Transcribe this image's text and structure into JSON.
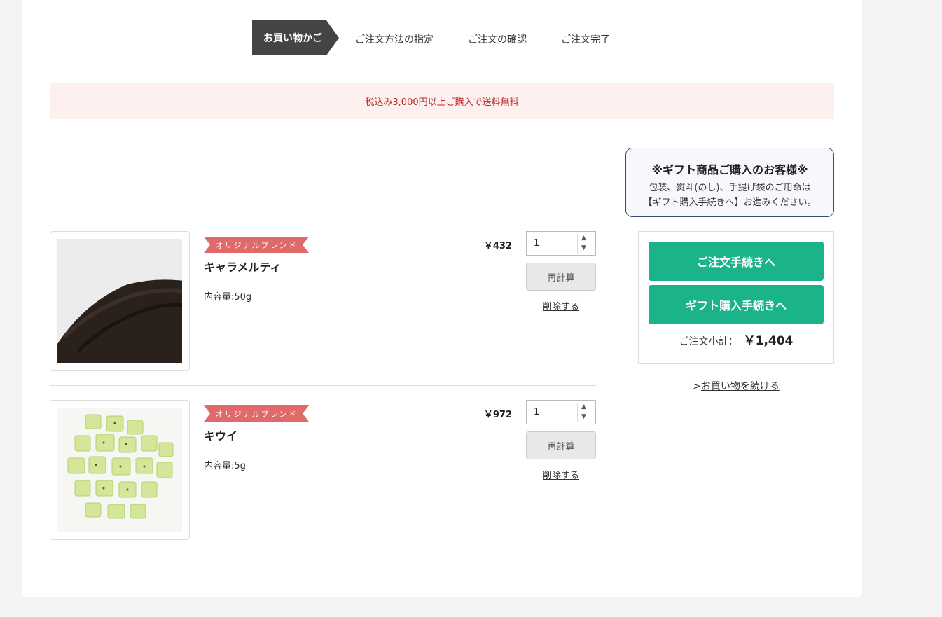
{
  "steps": [
    "お買い物かご",
    "ご注文方法の指定",
    "ご注文の確認",
    "ご注文完了"
  ],
  "notice": "税込み3,000円以上ご購入で送料無料",
  "gift_box": {
    "title": "※ギフト商品ご購入のお客様※",
    "line1": "包装、熨斗(のし)、手提げ袋のご用命は",
    "line2": "【ギフト購入手続きへ】お進みください。"
  },
  "order": {
    "checkout_label": "ご注文手続きへ",
    "gift_checkout_label": "ギフト購入手続きへ",
    "subtotal_label": "ご注文小計：",
    "subtotal_value": "￥1,404",
    "continue_prefix": ">",
    "continue_label": "お買い物を続ける"
  },
  "items": [
    {
      "badge": "オリジナルブレンド",
      "name": "キャラメルティ",
      "volume": "内容量:50g",
      "price": "￥432",
      "qty": "1",
      "recalc": "再計算",
      "delete": "削除する",
      "image": "black-tea-leaves"
    },
    {
      "badge": "オリジナルブレンド",
      "name": "キウイ",
      "volume": "内容量:5g",
      "price": "￥972",
      "qty": "1",
      "recalc": "再計算",
      "delete": "削除する",
      "image": "dried-kiwi-pieces"
    }
  ],
  "icons": {
    "spin_up": "▲",
    "spin_down": "▼"
  },
  "colors": {
    "accent": "#1ab38a",
    "badge": "#e06a6a",
    "notice_bg": "#fff0f0",
    "notice_text": "#b52a2a",
    "step_active": "#444444"
  }
}
